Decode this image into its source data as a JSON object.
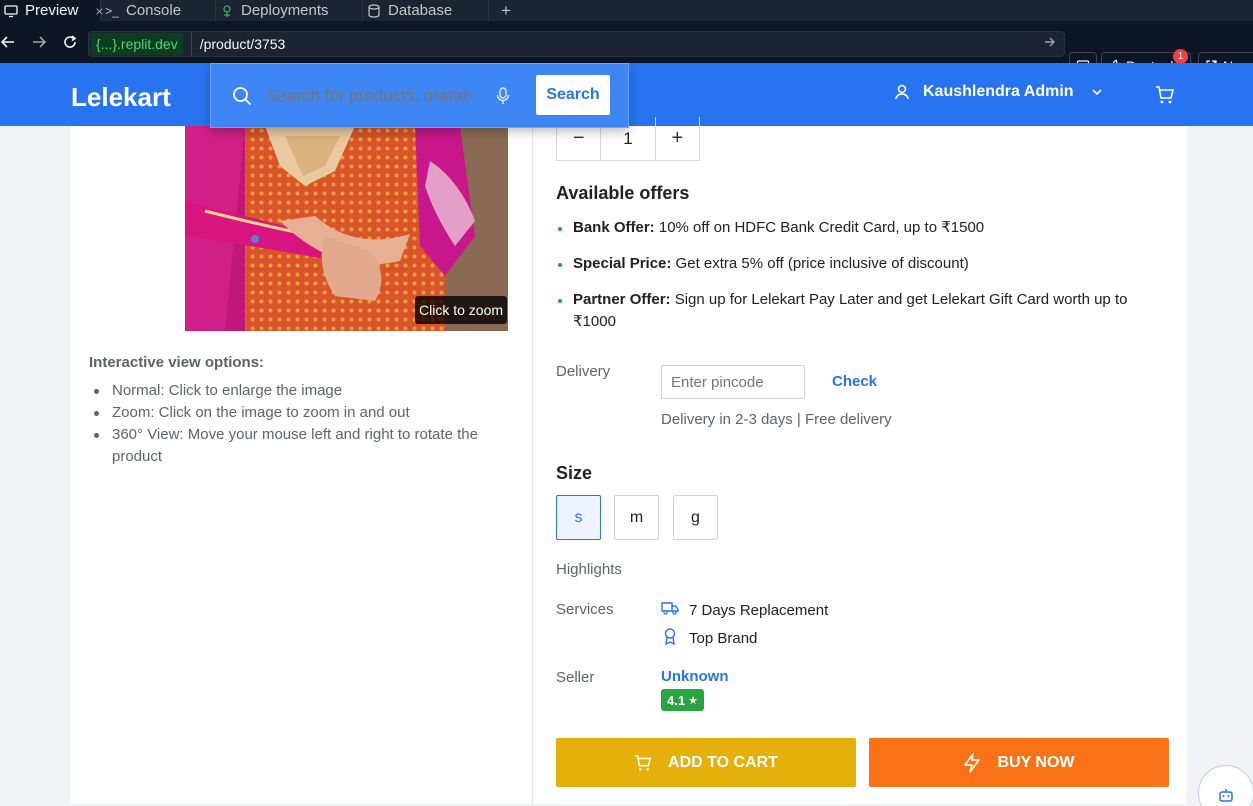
{
  "browser": {
    "tabs": [
      {
        "label": "Preview",
        "icon": "monitor-icon",
        "active": true
      },
      {
        "label": "Console",
        "icon": "terminal-icon",
        "active": false
      },
      {
        "label": "Deployments",
        "icon": "rocket-icon",
        "active": false
      },
      {
        "label": "Database",
        "icon": "database-icon",
        "active": false
      }
    ],
    "tab_close": "×",
    "new_tab": "+",
    "url_host": "{...}.replit.dev",
    "url_path": "/product/3753",
    "devtools_label": "Devtools",
    "devtools_badge": "1",
    "new_label": "New"
  },
  "header": {
    "logo": "Lelekart",
    "search_placeholder": "Search for products, brands and more",
    "search_button": "Search",
    "user_name": "Kaushlendra Admin",
    "accent": "#2874f0"
  },
  "gallery": {
    "zoom_hint": "Click to zoom",
    "options_title": "Interactive view options:",
    "options": [
      "Normal: Click to enlarge the image",
      "Zoom: Click on the image to zoom in and out",
      "360° View: Move your mouse left and right to rotate the product"
    ]
  },
  "quantity": {
    "minus": "−",
    "value": "1",
    "plus": "+"
  },
  "offers": {
    "title": "Available offers",
    "items": [
      {
        "label": "Bank Offer:",
        "text": " 10% off on HDFC Bank Credit Card, up to ₹1500"
      },
      {
        "label": "Special Price:",
        "text": " Get extra 5% off (price inclusive of discount)"
      },
      {
        "label": "Partner Offer:",
        "text": " Sign up for Lelekart Pay Later and get Lelekart Gift Card worth up to ₹1000"
      }
    ]
  },
  "delivery": {
    "label": "Delivery",
    "pincode_placeholder": "Enter pincode",
    "check": "Check",
    "info": "Delivery in 2-3 days | Free delivery"
  },
  "size": {
    "title": "Size",
    "options": [
      "s",
      "m",
      "g"
    ],
    "selected": "s"
  },
  "highlights": {
    "label": "Highlights"
  },
  "services": {
    "label": "Services",
    "items": [
      {
        "icon": "truck-icon",
        "text": "7 Days Replacement"
      },
      {
        "icon": "award-icon",
        "text": "Top Brand"
      }
    ]
  },
  "seller": {
    "label": "Seller",
    "name": "Unknown",
    "rating": "4.1",
    "rating_star": "★"
  },
  "actions": {
    "add_to_cart": "ADD TO CART",
    "buy_now": "BUY NOW",
    "cart_color": "#e6b00a",
    "buy_color": "#f97316"
  }
}
